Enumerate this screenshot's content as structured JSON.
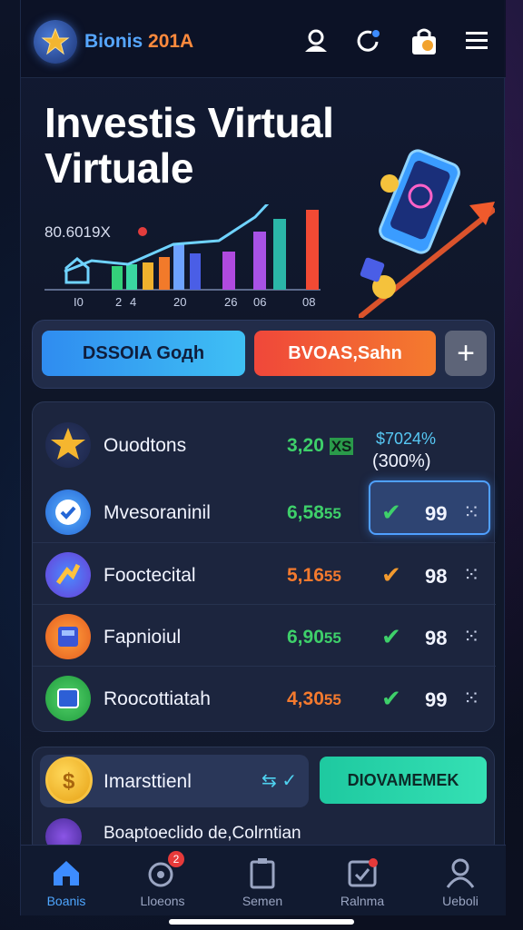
{
  "header": {
    "brand_a": "Bionis",
    "brand_b": "201A",
    "icons": [
      "user-icon",
      "refresh-icon",
      "shop-icon",
      "menu-icon"
    ]
  },
  "hero": {
    "title_line1": "Investis Virtual",
    "title_line2": "Virtuale",
    "chart_label": "80.6019X",
    "chart_ticks": [
      "I0",
      "2",
      "4",
      "20",
      "26",
      "06",
      "08"
    ]
  },
  "actions": {
    "primary_label": "DSSOIA Goдh",
    "secondary_label": "BVOAS,Sahn",
    "add_label": "+"
  },
  "list": {
    "rows": [
      {
        "name": "Ouodtons",
        "value": "3,20",
        "value_tag": "XS",
        "value_color": "#3ed06a",
        "pct_top": "$7024%",
        "pct_bottom": "(300%)"
      },
      {
        "name": "Mvesoraninil",
        "value": "6,58",
        "value_tag": "55",
        "value_color": "#3ed06a",
        "check_color": "#3ed06a",
        "num": "99"
      },
      {
        "name": "Fooctecital",
        "value": "5,16",
        "value_tag": "55",
        "value_color": "#f47a2e",
        "check_color": "#f29a2e",
        "num": "98"
      },
      {
        "name": "Fapnioiul",
        "value": "6,90",
        "value_tag": "55",
        "value_color": "#3ed06a",
        "check_color": "#3ed06a",
        "num": "98"
      },
      {
        "name": "Roocottiatah",
        "value": "4,30",
        "value_tag": "55",
        "value_color": "#f47a2e",
        "check_color": "#3ed06a",
        "num": "99"
      }
    ]
  },
  "lower": {
    "name": "Imarsttienl",
    "trend": "⇆ ✓",
    "button_label": "DIOVAMEMEK",
    "second_name": "Boaptoeclido de,Colrntian"
  },
  "nav": {
    "items": [
      {
        "label": "Boanis",
        "icon": "home-icon"
      },
      {
        "label": "Lloeons",
        "icon": "wallet-icon",
        "badge": "2"
      },
      {
        "label": "Semen",
        "icon": "document-icon"
      },
      {
        "label": "Ralnma",
        "icon": "calendar-icon"
      },
      {
        "label": "Ueboli",
        "icon": "profile-icon"
      }
    ]
  }
}
